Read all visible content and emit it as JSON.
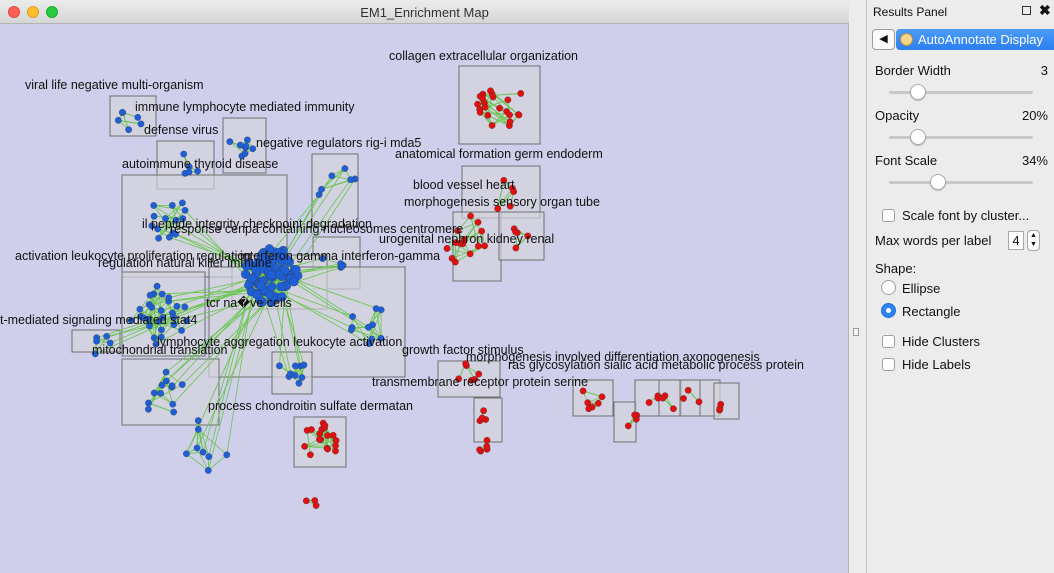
{
  "window": {
    "title": "EM1_Enrichment Map"
  },
  "colors": {
    "canvas_bg": "#cfcfeb",
    "cluster_fill": "#d4d4dc",
    "cluster_border": "#6f6f6f",
    "edge": "#66c64a",
    "node_red": "#e01010",
    "node_blue": "#1f5fd6",
    "accent": "#2a7ff0"
  },
  "clusters": [
    {
      "label": "collagen extracellular organization",
      "color": "red"
    },
    {
      "label": "viral life negative multi-organism",
      "color": "blue"
    },
    {
      "label": "immune lymphocyte mediated immunity",
      "color": "blue"
    },
    {
      "label": "defense virus",
      "color": "blue"
    },
    {
      "label": "negative regulators rig-i mda5",
      "color": "blue"
    },
    {
      "label": "anatomical formation germ endoderm",
      "color": "red"
    },
    {
      "label": "autoimmune thyroid disease",
      "color": "blue"
    },
    {
      "label": "blood vessel heart",
      "color": "red"
    },
    {
      "label": "morphogenesis sensory organ tube",
      "color": "red"
    },
    {
      "label": "il peptide integrity checkpoint degradation",
      "color": "blue"
    },
    {
      "label": "response cenpa containing nucleosomes centromere",
      "color": "blue"
    },
    {
      "label": "urogenital nephron kidney renal",
      "color": "red"
    },
    {
      "label": "activation leukocyte proliferation regulation",
      "color": "blue"
    },
    {
      "label": "interferon gamma interferon-gamma",
      "color": "blue"
    },
    {
      "label": "regulation natural killer immune",
      "color": "blue"
    },
    {
      "label": "tcr na�ve cells",
      "color": "blue"
    },
    {
      "label": "t-mediated signaling mediated stat4",
      "color": "blue"
    },
    {
      "label": "lymphocyte aggregation leukocyte activation",
      "color": "blue"
    },
    {
      "label": "mitochondrial translation",
      "color": "blue"
    },
    {
      "label": "growth factor stimulus",
      "color": "red"
    },
    {
      "label": "morphogenesis involved differentiation axonogenesis",
      "color": "red"
    },
    {
      "label": "ras glycosylation sialic acid metabolic process protein",
      "color": "red"
    },
    {
      "label": "transmembrane receptor protein serine",
      "color": "red"
    },
    {
      "label": "process chondroitin sulfate dermatan",
      "color": "red"
    }
  ],
  "panel": {
    "title": "Results Panel",
    "float_icon": "float-window-icon",
    "close_label": "✖",
    "back_label": "◀",
    "tab_label": "AutoAnnotate Display",
    "tab_icon": "palette-icon",
    "border_width": {
      "label": "Border Width",
      "value": "3",
      "level": 0.2
    },
    "opacity": {
      "label": "Opacity",
      "value": "20%",
      "level": 0.2
    },
    "font_scale": {
      "label": "Font Scale",
      "value": "34%",
      "level": 0.34
    },
    "scale_font_label": "Scale font by cluster...",
    "scale_font_checked": false,
    "max_words_label": "Max words per label",
    "max_words_value": "4",
    "shape_label": "Shape:",
    "shape_options": [
      "Ellipse",
      "Rectangle"
    ],
    "shape_selected": "Rectangle",
    "hide_clusters_label": "Hide Clusters",
    "hide_labels_label": "Hide Labels"
  }
}
